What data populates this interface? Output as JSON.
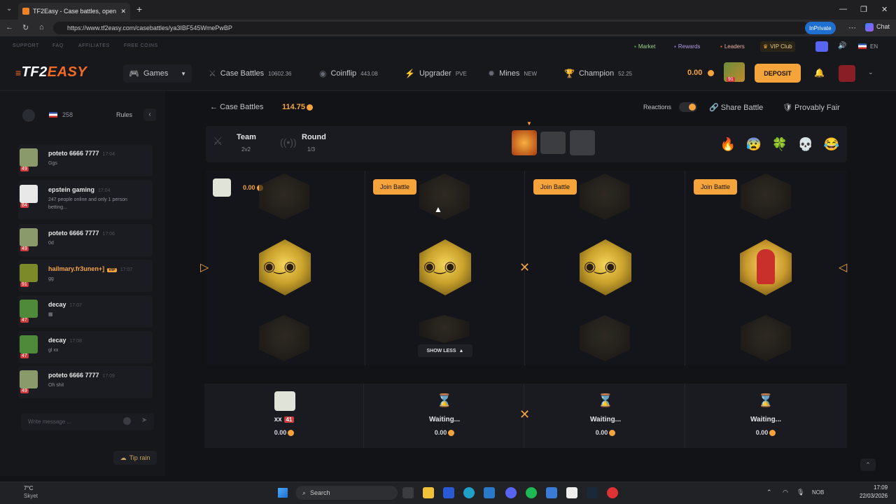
{
  "browser": {
    "tab_title": "TF2Easy - Case battles, open case...",
    "url": "https://www.tf2easy.com/casebattles/ya3IBF545WmePwBP",
    "inprivate": "InPrivate",
    "chat_label": "Chat"
  },
  "topline": {
    "links": [
      "SUPPORT",
      "FAQ",
      "AFFILIATES",
      "FREE COINS"
    ],
    "market": "Market",
    "rewards": "Rewards",
    "leaders": "Leaders",
    "vip": "VIP Club",
    "lang": "EN"
  },
  "header": {
    "logo_a": "TF2",
    "logo_b": "EASY",
    "games": "Games",
    "case_battles": "Case Battles",
    "case_battles_val": "10602.36",
    "coinflip": "Coinflip",
    "coinflip_val": "443.08",
    "upgrader": "Upgrader",
    "upgrader_tag": "PVE",
    "mines": "Mines",
    "mines_tag": "NEW",
    "champion": "Champion",
    "champion_val": "52.25",
    "balance": "0.00",
    "user_level": "91",
    "deposit": "DEPOSIT"
  },
  "sidebar": {
    "online_count": "258",
    "rules": "Rules",
    "messages": [
      {
        "name": "poteto 6666 7777",
        "time": "17:04",
        "text": "Ggs",
        "level": "49"
      },
      {
        "name": "epstein gaming",
        "time": "17:04",
        "text": "247 people online and only 1 person betting...",
        "level": "84"
      },
      {
        "name": "poteto 6666 7777",
        "time": "17:06",
        "text": "0d",
        "level": "49"
      },
      {
        "name": "hailmary.fr3unen+]",
        "time": "17:07",
        "text": "gg",
        "level": "91",
        "badge": "VIP"
      },
      {
        "name": "decay",
        "time": "17:07",
        "text": "",
        "level": "47"
      },
      {
        "name": "decay",
        "time": "17:08",
        "text": "gl xx",
        "level": "47"
      },
      {
        "name": "poteto 6666 7777",
        "time": "17:09",
        "text": "Oh shit",
        "level": "49"
      }
    ],
    "input_placeholder": "Write message ...",
    "tip_rain": "Tip rain"
  },
  "battle": {
    "back": "Case Battles",
    "total": "114.75",
    "reactions": "Reactions",
    "share": "Share Battle",
    "provably_fair": "Provably Fair",
    "mode_label": "Team",
    "mode_value": "2v2",
    "round_label": "Round",
    "round_value": "1/3",
    "emojis": [
      "🔥",
      "😰",
      "🍀",
      "💀",
      "😂"
    ],
    "slot1_value": "0.00",
    "join": "Join Battle",
    "show_less": "SHOW LESS"
  },
  "players": [
    {
      "name": "xx",
      "level": "41",
      "value": "0.00"
    },
    {
      "name": "Waiting...",
      "value": "0.00"
    },
    {
      "name": "Waiting...",
      "value": "0.00"
    },
    {
      "name": "Waiting...",
      "value": "0.00"
    }
  ],
  "taskbar": {
    "temp": "7°C",
    "weather": "Skyet",
    "search": "Search",
    "ime": "NOB",
    "time": "17:09",
    "date": "22/03/2026"
  },
  "colors": {
    "accent": "#f5a43b",
    "brand": "#f36b24",
    "level_badge": "#d03a3a",
    "bg": "#121316"
  }
}
